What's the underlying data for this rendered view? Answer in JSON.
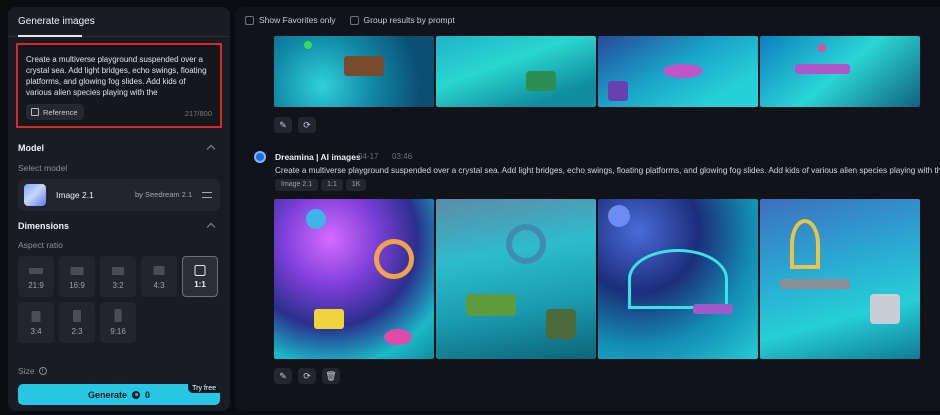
{
  "left_panel": {
    "tab_label": "Generate images",
    "prompt": {
      "text": "Create a multiverse playground suspended over a crystal sea. Add light bridges, echo swings, floating platforms, and glowing fog slides. Add kids of various alien species playing with the",
      "reference_label": "Reference",
      "char_count": "217/800"
    },
    "model_section": {
      "title": "Model",
      "select_label": "Select model",
      "model_name": "Image 2.1",
      "model_by": "by Seedream 2.1"
    },
    "dimensions_section": {
      "title": "Dimensions",
      "aspect_label": "Aspect ratio",
      "ratios": [
        "21:9",
        "16:9",
        "3:2",
        "4:3",
        "1:1",
        "3:4",
        "2:3",
        "9:16"
      ],
      "selected_ratio": "1:1"
    },
    "size_label": "Size",
    "generate": {
      "label": "Generate",
      "cost": "0",
      "badge": "Try free",
      "color": "#26c7e2"
    }
  },
  "right_panel": {
    "filters": {
      "favorites_label": "Show Favorites only",
      "group_label": "Group results by prompt"
    },
    "generation": {
      "source": "Dreamina | AI images",
      "date": "04-17",
      "time": "03:46",
      "prompt": "Create a multiverse playground suspended over a crystal sea. Add light bridges, echo swings, floating platforms, and glowing fog slides. Add kids of various alien species playing with the",
      "tags": [
        "Image 2.1",
        "1:1",
        "1K"
      ]
    },
    "actions": {
      "edit_icon": "pencil-icon",
      "regenerate_icon": "refresh-icon",
      "delete_icon": "trash-icon"
    }
  },
  "colors": {
    "accent": "#26c7e2",
    "highlight_border": "#d42a2a",
    "panel_bg": "#1a1c23",
    "page_bg": "#0b0c10"
  }
}
